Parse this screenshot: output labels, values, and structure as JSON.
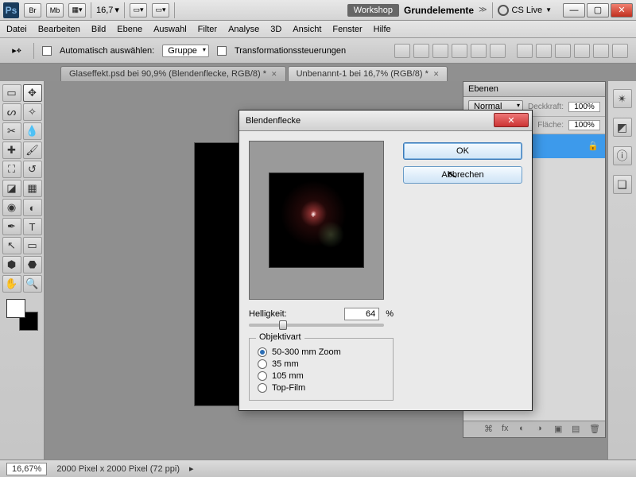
{
  "title_bar": {
    "br": "Br",
    "mb": "Mb",
    "zoom": "16,7",
    "workshop_btn": "Workshop",
    "workspace_label": "Grundelemente",
    "cslive": "CS Live"
  },
  "menu": [
    "Datei",
    "Bearbeiten",
    "Bild",
    "Ebene",
    "Auswahl",
    "Filter",
    "Analyse",
    "3D",
    "Ansicht",
    "Fenster",
    "Hilfe"
  ],
  "options": {
    "auto_select": "Automatisch auswählen:",
    "group": "Gruppe",
    "transform": "Transformationssteuerungen"
  },
  "doc_tabs": [
    {
      "label": "Glaseffekt.psd bei 90,9% (Blendenflecke, RGB/8) *"
    },
    {
      "label": "Unbenannt-1 bei 16,7% (RGB/8) *"
    }
  ],
  "layers_panel": {
    "title": "Ebenen",
    "blend": "Normal",
    "opacity_label": "Deckkraft:",
    "opacity": "100%",
    "fill_label": "Fläche:",
    "fill": "100%"
  },
  "status": {
    "zoom": "16,67%",
    "info": "2000 Pixel x 2000 Pixel (72 ppi)"
  },
  "dialog": {
    "title": "Blendenflecke",
    "ok": "OK",
    "cancel": "Abbrechen",
    "brightness_label": "Helligkeit:",
    "brightness_value": "64",
    "percent": "%",
    "lens_legend": "Objektivart",
    "lens_options": [
      "50-300 mm Zoom",
      "35 mm",
      "105 mm",
      "Top-Film"
    ],
    "lens_selected": 0
  }
}
